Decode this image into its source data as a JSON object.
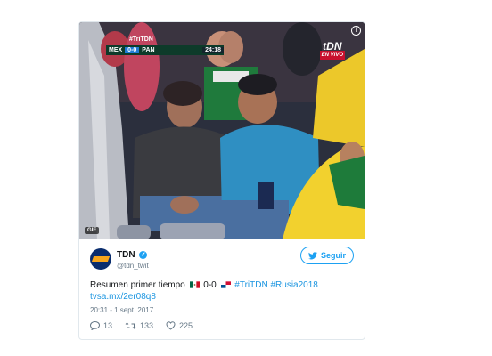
{
  "media": {
    "hashtag_tag": "#TriTDN",
    "home_team": "MEX",
    "score": "0-0",
    "away_team": "PAN",
    "clock": "24:18",
    "channel_logo": "tDN",
    "channel_sub": "EN VIVO",
    "gif_badge": "GIF"
  },
  "author": {
    "name": "TDN",
    "handle": "@tdn_twit"
  },
  "follow_label": "Seguir",
  "tweet": {
    "text_before": "Resumen primer tiempo",
    "score_text": "0-0",
    "hashtags": "#TriTDN #Rusia2018",
    "link": "tvsa.mx/2er08q8"
  },
  "timestamp": "20:31 - 1 sept. 2017",
  "actions": {
    "replies": "13",
    "retweets": "133",
    "likes": "225"
  },
  "colors": {
    "accent": "#1da1f2",
    "link": "#1b95e0",
    "muted": "#657786"
  }
}
